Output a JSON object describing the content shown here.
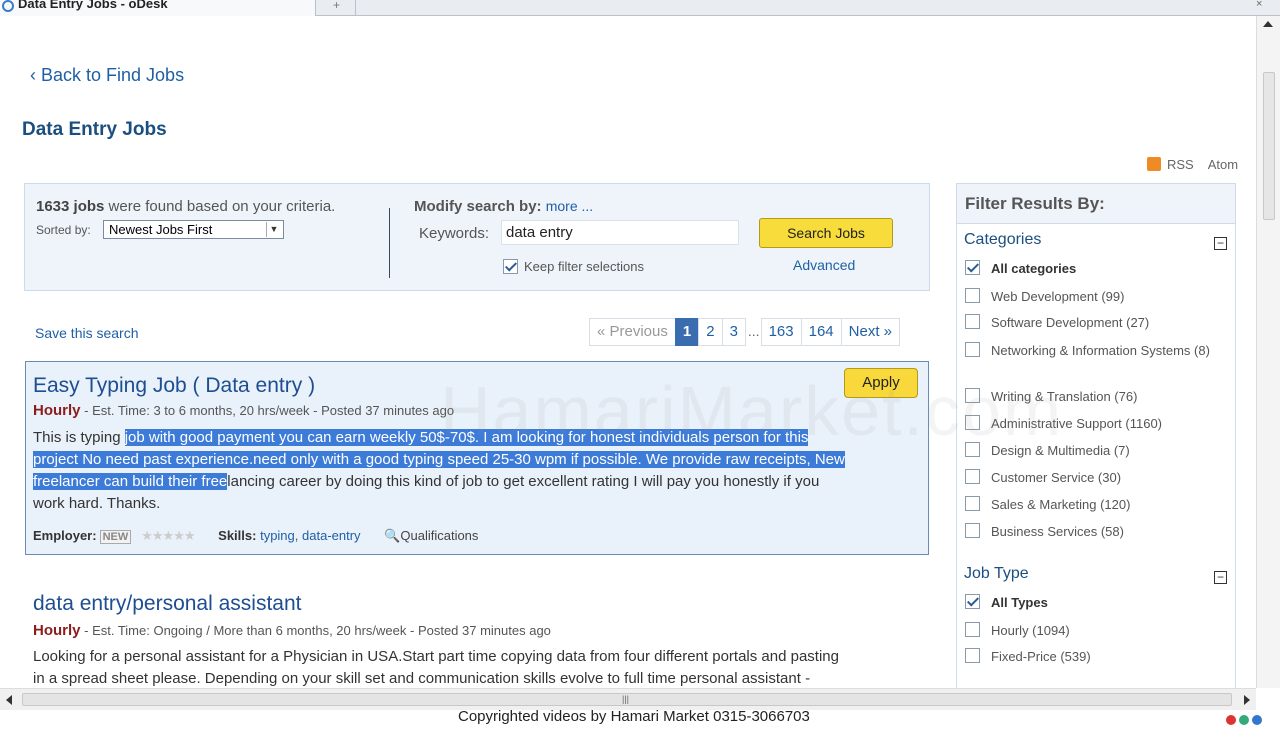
{
  "browser": {
    "tab_title": "Data Entry Jobs - oDesk",
    "newtab_symbol": "+",
    "close_symbol": "×"
  },
  "nav": {
    "back_link": "Back to Find Jobs"
  },
  "page_title": "Data Entry Jobs",
  "feeds": {
    "rss": "RSS",
    "atom": "Atom"
  },
  "search": {
    "count": "1633 jobs",
    "count_suffix": " were found based on your criteria.",
    "sorted_by_label": "Sorted by:",
    "sorted_by_value": "Newest Jobs First",
    "modify_label": "Modify search by:",
    "modify_more": "more ...",
    "keywords_label": "Keywords:",
    "keywords_value": "data entry",
    "search_button": "Search Jobs",
    "keep_filter_label": "Keep filter selections",
    "keep_filter_checked": true,
    "advanced_link": "Advanced"
  },
  "save_search": "Save this search",
  "pagination": {
    "previous": "« Previous",
    "pages": [
      "1",
      "2",
      "3"
    ],
    "ellipsis": "...",
    "last_pages": [
      "163",
      "164"
    ],
    "next": "Next »",
    "current": "1"
  },
  "jobs": [
    {
      "title": "Easy Typing Job ( Data entry )",
      "type": "Hourly",
      "meta": " - Est. Time: 3 to 6 months, 20 hrs/week - Posted 37 minutes ago",
      "apply_label": "Apply",
      "desc_plain_start": "This is typing ",
      "desc_highlight_1": "job with good payment you can earn weekly 50$-70$. I am looking for honest individuals person for this",
      "desc_highlight_2": "project No need past experience.need only with a good typing speed 25-30 wpm if possible. We provide raw receipts, New",
      "desc_highlight_3": "freelancer can build their free",
      "desc_plain_end": "lancing career by doing this kind of job to get excellent rating I will pay you honestly if you",
      "desc_line_4": "work hard. Thanks.",
      "employer_label": "Employer:",
      "employer_badge": "NEW",
      "stars": "★★★★★",
      "skills_label": "Skills:",
      "skills": [
        "typing",
        "data-entry"
      ],
      "qualifications": "Qualifications"
    },
    {
      "title": "data entry/personal assistant",
      "type": "Hourly",
      "meta": " - Est. Time: Ongoing / More than 6 months, 20 hrs/week - Posted 37 minutes ago",
      "desc_line_1": "Looking for a personal assistant for a Physician in USA.Start part time copying data from four different portals and pasting",
      "desc_line_2": "in a spread sheet please. Depending on your skill set and communication skills evolve to full time personal assistant -"
    }
  ],
  "filter": {
    "header": "Filter Results By:",
    "categories_title": "Categories",
    "categories": [
      {
        "label": "All categories",
        "checked": true
      },
      {
        "label": "Web Development (99)",
        "checked": false
      },
      {
        "label": "Software Development (27)",
        "checked": false
      },
      {
        "label": "Networking & Information Systems (8)",
        "checked": false
      },
      {
        "label": "Writing & Translation (76)",
        "checked": false
      },
      {
        "label": "Administrative Support (1160)",
        "checked": false
      },
      {
        "label": "Design & Multimedia (7)",
        "checked": false
      },
      {
        "label": "Customer Service (30)",
        "checked": false
      },
      {
        "label": "Sales & Marketing (120)",
        "checked": false
      },
      {
        "label": "Business Services (58)",
        "checked": false
      }
    ],
    "jobtype_title": "Job Type",
    "jobtypes": [
      {
        "label": "All Types",
        "checked": true
      },
      {
        "label": "Hourly (1094)",
        "checked": false
      },
      {
        "label": "Fixed-Price (539)",
        "checked": false
      }
    ],
    "collapse_symbol": "−"
  },
  "watermark": "HamariMarket.com",
  "copyright": "Copyrighted videos by Hamari Market 0315-3066703",
  "scroll_grip": "|||"
}
